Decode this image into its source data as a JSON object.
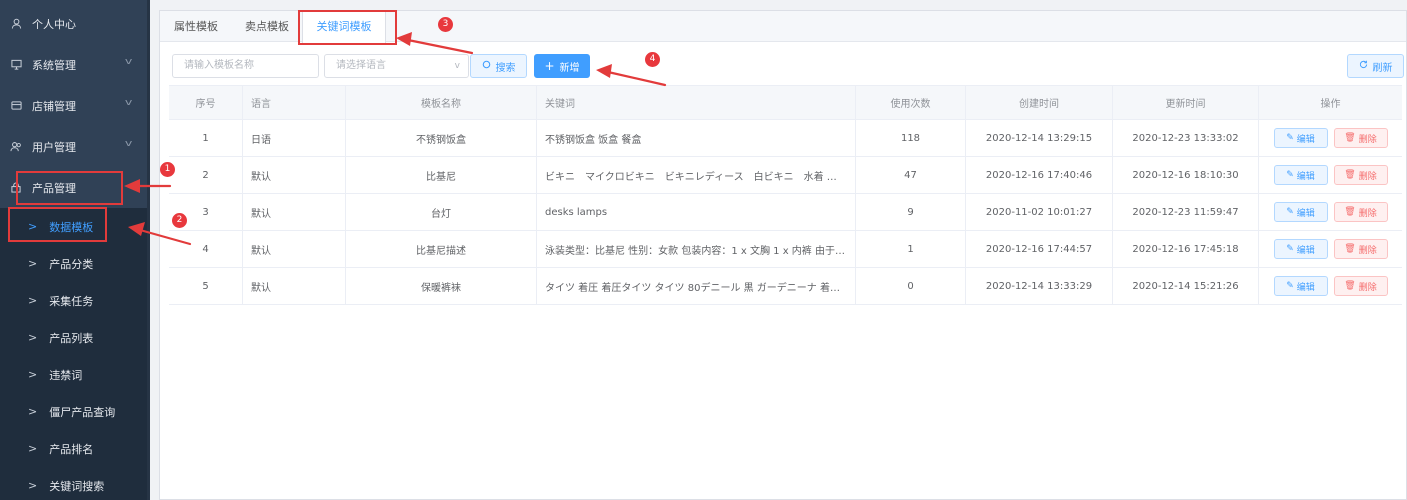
{
  "sidebar": {
    "menus": [
      {
        "label": "个人中心",
        "icon": "user-icon"
      },
      {
        "label": "系统管理",
        "icon": "monitor-icon"
      },
      {
        "label": "店铺管理",
        "icon": "store-icon"
      },
      {
        "label": "用户管理",
        "icon": "users-icon"
      },
      {
        "label": "产品管理",
        "icon": "lock-icon"
      }
    ],
    "subitems": [
      {
        "label": "数据模板",
        "active": true
      },
      {
        "label": "产品分类"
      },
      {
        "label": "采集任务"
      },
      {
        "label": "产品列表"
      },
      {
        "label": "违禁词"
      },
      {
        "label": "僵尸产品查询"
      },
      {
        "label": "产品排名"
      },
      {
        "label": "关键词搜索"
      }
    ]
  },
  "tabs": [
    {
      "label": "属性模板"
    },
    {
      "label": "卖点模板"
    },
    {
      "label": "关键词模板",
      "active": true
    }
  ],
  "filters": {
    "name_placeholder": "请输入模板名称",
    "language_placeholder": "请选择语言",
    "search_label": "搜索",
    "add_label": "新增",
    "refresh_label": "刷新"
  },
  "table": {
    "headers": [
      "序号",
      "语言",
      "模板名称",
      "关键词",
      "使用次数",
      "创建时间",
      "更新时间",
      "操作"
    ],
    "rows": [
      {
        "no": "1",
        "lang": "日语",
        "name": "不锈钢饭盒",
        "keywords": "不锈钢饭盒 饭盒 餐盒",
        "uses": "118",
        "created": "2020-12-14 13:29:15",
        "updated": "2020-12-23 13:33:02"
      },
      {
        "no": "2",
        "lang": "默认",
        "name": "比基尼",
        "keywords": "ビキニ　マイクロビキニ　ビキニレディース　白ビキニ　水着 …",
        "uses": "47",
        "created": "2020-12-16 17:40:46",
        "updated": "2020-12-16 18:10:30"
      },
      {
        "no": "3",
        "lang": "默认",
        "name": "台灯",
        "keywords": "desks lamps",
        "uses": "9",
        "created": "2020-11-02 10:01:27",
        "updated": "2020-12-23 11:59:47"
      },
      {
        "no": "4",
        "lang": "默认",
        "name": "比基尼描述",
        "keywords": "泳装类型：比基尼 性别：女款 包装内容：1 x 文胸 1 x 内裤 由于…",
        "uses": "1",
        "created": "2020-12-16 17:44:57",
        "updated": "2020-12-16 17:45:18"
      },
      {
        "no": "5",
        "lang": "默认",
        "name": "保暖裤袜",
        "keywords": "タイツ 着圧 着圧タイツ タイツ 80デニール 黒 ガーデニーナ 着…",
        "uses": "0",
        "created": "2020-12-14 13:33:29",
        "updated": "2020-12-14 15:21:26"
      }
    ],
    "edit_label": "编辑",
    "delete_label": "删除"
  },
  "annotations": [
    "1",
    "2",
    "3",
    "4"
  ],
  "colors": {
    "sidebar": "#304156",
    "primary": "#409eff",
    "danger": "#f56c6c",
    "annotation": "#e23b3b"
  }
}
